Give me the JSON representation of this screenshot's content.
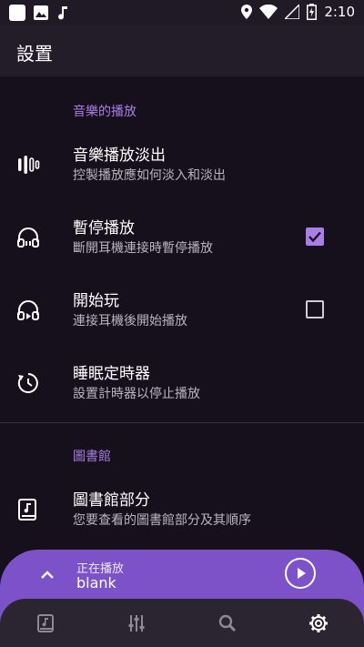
{
  "status_bar": {
    "time": "2:10"
  },
  "app_bar": {
    "title": "設置"
  },
  "sections": {
    "playback": {
      "header": "音樂的播放",
      "items": [
        {
          "title": "音樂播放淡出",
          "summary": "控製播放應如何淡入和淡出",
          "icon": "volume-bars-icon"
        },
        {
          "title": "暫停播放",
          "summary": "斷開耳機連接時暫停播放",
          "icon": "headphones-icon",
          "checked": true
        },
        {
          "title": "開始玩",
          "summary": "連接耳機後開始播放",
          "icon": "headphones-play-icon",
          "checked": false
        },
        {
          "title": "睡眠定時器",
          "summary": "設置計時器以停止播放",
          "icon": "timer-icon"
        }
      ]
    },
    "library": {
      "header": "圖書館",
      "items": [
        {
          "title": "圖書館部分",
          "summary": "您要查看的圖書館部分及其順序",
          "icon": "library-icon"
        }
      ]
    }
  },
  "now_playing": {
    "label": "正在播放",
    "title": "blank"
  },
  "bottom_nav": {
    "items": [
      "library-icon",
      "equalizer-icon",
      "search-icon",
      "settings-icon"
    ],
    "active": "settings-icon"
  },
  "colors": {
    "accent": "#a97ee6",
    "now_playing_bg": "#7d52c8",
    "background": "#16101c"
  }
}
